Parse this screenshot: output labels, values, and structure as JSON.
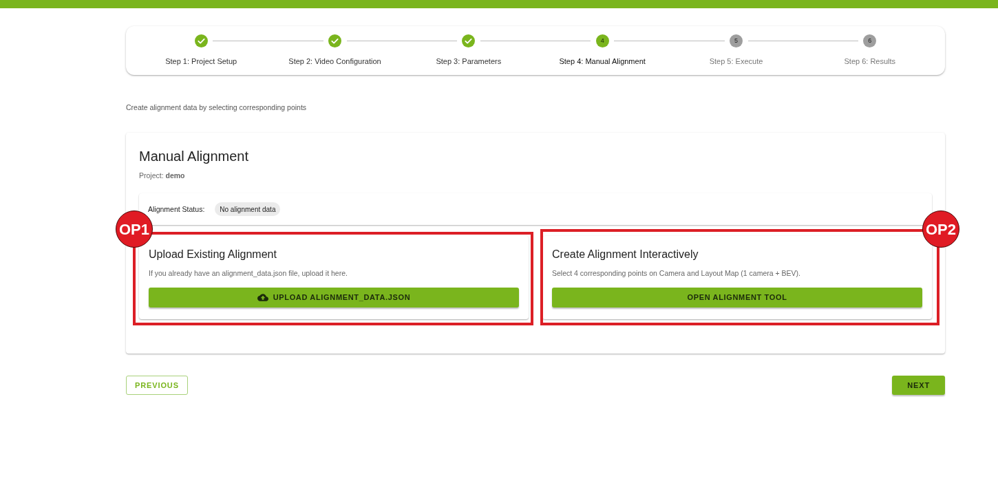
{
  "stepper": {
    "steps": [
      {
        "label": "Step 1: Project Setup",
        "completed": true,
        "selected": false
      },
      {
        "label": "Step 2: Video Configuration",
        "completed": true,
        "selected": false
      },
      {
        "label": "Step 3: Parameters",
        "completed": true,
        "selected": false
      },
      {
        "label": "Step 4: Manual Alignment",
        "number": "4",
        "completed": false,
        "selected": true
      },
      {
        "label": "Step 5: Execute",
        "number": "5",
        "completed": false,
        "selected": false
      },
      {
        "label": "Step 6: Results",
        "number": "6",
        "completed": false,
        "selected": false
      }
    ]
  },
  "subtitle": "Create alignment data by selecting corresponding points",
  "panel": {
    "title": "Manual Alignment",
    "project": "Project: **demo**",
    "status": {
      "label": "Alignment Status:",
      "chip": "No alignment data"
    },
    "options": [
      {
        "title": "Upload Existing Alignment",
        "description": "If you already have an alignment_data.json file, upload it here.",
        "button": {
          "label": "UPLOAD ALIGNMENT_DATA.JSON",
          "icon": true
        },
        "callout": "OP1"
      },
      {
        "title": "Create Alignment Interactively",
        "description": "Select 4 corresponding points on Camera and Layout Map (1 camera + BEV).",
        "button": {
          "label": "OPEN ALIGNMENT TOOL",
          "icon": false
        },
        "callout": "OP2"
      }
    ]
  },
  "navigation": {
    "previous": "PREVIOUS",
    "next": "NEXT"
  }
}
